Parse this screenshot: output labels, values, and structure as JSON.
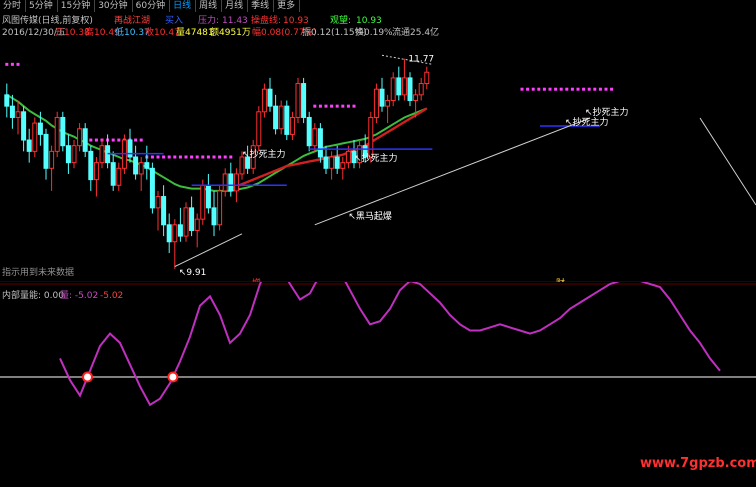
{
  "tabs": [
    "分时",
    "5分钟",
    "15分钟",
    "30分钟",
    "60分钟",
    "日线",
    "周线",
    "月线",
    "季线",
    "更多"
  ],
  "active_tab": 5,
  "header": {
    "title": "风图传媒(日线,前复权)",
    "signal": "再战江湖",
    "state": "买入",
    "resistance_label": "压力:",
    "resistance": "11.43",
    "stop_label": "操盘线:",
    "stop": "10.93",
    "watch_label": "观望:",
    "watch": "10.93"
  },
  "quote": {
    "date": "2016/12/30/五",
    "open_label": "开",
    "open": "10.38",
    "high_label": "高",
    "high": "10.49",
    "low_label": "低",
    "low": "10.37",
    "close_label": "收",
    "close": "10.47",
    "vol": "量47481",
    "amount": "额4951万",
    "change": "幅0.08(0.77%)",
    "amp": "振0.12(1.15%)",
    "turnover": "换0.19%",
    "float": "流通25.4亿"
  },
  "colors": {
    "up": "#ff3030",
    "down": "#54ffff",
    "green_ma": "#3dbd3d",
    "red_ma": "#d02020",
    "magenta": "#ff40ff",
    "blue_level": "#3030ff",
    "indicator": "#c030c0"
  },
  "chart_data": [
    {
      "type": "candlestick",
      "title": "风图传媒(日线,前复权)",
      "ylim": [
        9.9,
        11.9
      ],
      "annotations": [
        {
          "text": "11.77",
          "index": 71
        },
        {
          "text": "9.91",
          "index": 30
        },
        {
          "text": "抄死主力",
          "index": 44
        },
        {
          "text": "抄死主力",
          "index": 66
        },
        {
          "text": "黑马起爆",
          "index": 66
        },
        {
          "text": "抄死主力",
          "index": 113
        },
        {
          "text": "抄死主力",
          "index": 111
        }
      ],
      "watermark": "指示用到未来数据",
      "markers": [
        {
          "text": "增",
          "index": 49
        },
        {
          "text": "财",
          "index": 110
        }
      ],
      "candles": [
        [
          11.45,
          11.55,
          11.25,
          11.35
        ],
        [
          11.35,
          11.45,
          11.15,
          11.25
        ],
        [
          11.25,
          11.4,
          11.1,
          11.3
        ],
        [
          11.3,
          11.35,
          10.95,
          11.05
        ],
        [
          11.05,
          11.15,
          10.85,
          10.95
        ],
        [
          10.95,
          11.25,
          10.9,
          11.2
        ],
        [
          11.2,
          11.3,
          11.0,
          11.1
        ],
        [
          11.1,
          11.15,
          10.7,
          10.8
        ],
        [
          10.8,
          11.0,
          10.6,
          10.95
        ],
        [
          10.95,
          11.3,
          10.9,
          11.25
        ],
        [
          11.25,
          11.3,
          10.95,
          11.0
        ],
        [
          11.0,
          11.1,
          10.75,
          10.85
        ],
        [
          10.85,
          11.05,
          10.8,
          11.0
        ],
        [
          11.0,
          11.2,
          10.95,
          11.15
        ],
        [
          11.15,
          11.2,
          10.9,
          10.95
        ],
        [
          10.95,
          11.0,
          10.6,
          10.7
        ],
        [
          10.7,
          10.9,
          10.55,
          10.85
        ],
        [
          10.85,
          11.05,
          10.8,
          11.0
        ],
        [
          11.0,
          11.1,
          10.8,
          10.85
        ],
        [
          10.85,
          10.95,
          10.6,
          10.65
        ],
        [
          10.65,
          10.85,
          10.6,
          10.8
        ],
        [
          10.8,
          11.1,
          10.75,
          11.05
        ],
        [
          11.05,
          11.15,
          10.85,
          10.9
        ],
        [
          10.9,
          11.0,
          10.7,
          10.75
        ],
        [
          10.75,
          10.9,
          10.6,
          10.85
        ],
        [
          10.85,
          11.0,
          10.7,
          10.8
        ],
        [
          10.8,
          10.85,
          10.4,
          10.45
        ],
        [
          10.45,
          10.6,
          10.25,
          10.55
        ],
        [
          10.55,
          10.65,
          10.2,
          10.3
        ],
        [
          10.3,
          10.4,
          10.05,
          10.15
        ],
        [
          10.15,
          10.35,
          9.91,
          10.3
        ],
        [
          10.3,
          10.45,
          10.15,
          10.2
        ],
        [
          10.2,
          10.5,
          10.15,
          10.45
        ],
        [
          10.45,
          10.55,
          10.2,
          10.25
        ],
        [
          10.25,
          10.4,
          10.1,
          10.35
        ],
        [
          10.35,
          10.7,
          10.3,
          10.65
        ],
        [
          10.65,
          10.75,
          10.4,
          10.45
        ],
        [
          10.45,
          10.6,
          10.2,
          10.3
        ],
        [
          10.3,
          10.65,
          10.25,
          10.6
        ],
        [
          10.6,
          10.8,
          10.55,
          10.75
        ],
        [
          10.75,
          10.85,
          10.55,
          10.6
        ],
        [
          10.6,
          10.8,
          10.5,
          10.75
        ],
        [
          10.75,
          10.95,
          10.7,
          10.9
        ],
        [
          10.9,
          11.0,
          10.75,
          10.8
        ],
        [
          10.8,
          11.05,
          10.75,
          11.0
        ],
        [
          11.0,
          11.35,
          10.95,
          11.3
        ],
        [
          11.3,
          11.55,
          11.25,
          11.5
        ],
        [
          11.5,
          11.6,
          11.3,
          11.35
        ],
        [
          11.35,
          11.45,
          11.1,
          11.15
        ],
        [
          11.15,
          11.4,
          11.1,
          11.35
        ],
        [
          11.35,
          11.4,
          11.05,
          11.1
        ],
        [
          11.1,
          11.3,
          11.05,
          11.25
        ],
        [
          11.25,
          11.6,
          11.2,
          11.55
        ],
        [
          11.55,
          11.6,
          11.2,
          11.25
        ],
        [
          11.25,
          11.3,
          10.95,
          11.0
        ],
        [
          11.0,
          11.2,
          10.95,
          11.15
        ],
        [
          11.15,
          11.2,
          10.85,
          10.9
        ],
        [
          10.9,
          11.0,
          10.75,
          10.8
        ],
        [
          10.8,
          10.95,
          10.7,
          10.9
        ],
        [
          10.9,
          11.0,
          10.75,
          10.8
        ],
        [
          10.8,
          10.9,
          10.7,
          10.85
        ],
        [
          10.85,
          11.0,
          10.8,
          10.95
        ],
        [
          10.95,
          11.05,
          10.8,
          10.85
        ],
        [
          10.85,
          11.05,
          10.8,
          11.0
        ],
        [
          11.0,
          11.1,
          10.85,
          10.9
        ],
        [
          10.9,
          11.3,
          10.85,
          11.25
        ],
        [
          11.25,
          11.55,
          11.2,
          11.5
        ],
        [
          11.5,
          11.6,
          11.3,
          11.35
        ],
        [
          11.35,
          11.45,
          11.2,
          11.4
        ],
        [
          11.4,
          11.65,
          11.35,
          11.6
        ],
        [
          11.6,
          11.7,
          11.4,
          11.45
        ],
        [
          11.45,
          11.77,
          11.4,
          11.6
        ],
        [
          11.6,
          11.65,
          11.35,
          11.4
        ],
        [
          11.4,
          11.5,
          11.25,
          11.45
        ],
        [
          11.45,
          11.6,
          11.4,
          11.55
        ],
        [
          11.55,
          11.7,
          11.5,
          11.65
        ]
      ],
      "ma_green": [
        11.45,
        11.42,
        11.39,
        11.35,
        11.31,
        11.28,
        11.25,
        11.22,
        11.18,
        11.15,
        11.12,
        11.1,
        11.08,
        11.05,
        11.03,
        11.0,
        10.98,
        10.96,
        10.94,
        10.92,
        10.9,
        10.88,
        10.87,
        10.85,
        10.83,
        10.81,
        10.78,
        10.75,
        10.72,
        10.69,
        10.66,
        10.64,
        10.63,
        10.62,
        10.62,
        10.62,
        10.61,
        10.6,
        10.6,
        10.6,
        10.6,
        10.61,
        10.62,
        10.63,
        10.65,
        10.67,
        10.7,
        10.73,
        10.76,
        10.79,
        10.82,
        10.85,
        10.88,
        10.91,
        10.93,
        10.95,
        10.97,
        10.99,
        11.0,
        11.01,
        11.02,
        11.03,
        11.04,
        11.05,
        11.06,
        11.08,
        11.1,
        11.13,
        11.16,
        11.19,
        11.22,
        11.25,
        11.27,
        11.29,
        11.31,
        11.33
      ],
      "ma_red": [
        null,
        null,
        null,
        null,
        null,
        null,
        null,
        null,
        null,
        null,
        null,
        null,
        null,
        null,
        null,
        null,
        null,
        null,
        null,
        null,
        null,
        null,
        null,
        null,
        null,
        null,
        null,
        null,
        null,
        null,
        null,
        null,
        null,
        null,
        null,
        null,
        null,
        null,
        null,
        null,
        10.62,
        10.64,
        10.66,
        10.68,
        10.7,
        10.72,
        10.74,
        10.76,
        10.78,
        10.8,
        10.82,
        10.83,
        10.84,
        10.85,
        10.86,
        10.87,
        10.88,
        10.89,
        10.9,
        10.91,
        10.92,
        10.94,
        10.96,
        10.98,
        11.0,
        11.03,
        11.06,
        11.09,
        11.12,
        11.15,
        11.18,
        11.21,
        11.24,
        11.27,
        11.3,
        11.33
      ]
    },
    {
      "type": "line",
      "title": "内部量能",
      "values_text": [
        "0.00",
        "量: -5.02",
        "-5.02"
      ],
      "values": [
        12,
        -2,
        -12,
        4,
        20,
        28,
        22,
        8,
        -6,
        -18,
        -14,
        -4,
        10,
        26,
        46,
        52,
        40,
        22,
        28,
        40,
        60,
        74,
        72,
        60,
        50,
        54,
        66,
        74,
        68,
        56,
        44,
        34,
        36,
        44,
        56,
        62,
        60,
        54,
        48,
        40,
        34,
        30,
        30,
        32,
        34,
        32,
        30,
        28,
        30,
        34,
        38,
        44,
        48,
        52,
        56,
        60,
        62,
        64,
        62,
        60,
        58,
        50,
        40,
        30,
        22,
        12,
        4
      ],
      "baseline": 0
    }
  ],
  "footer": {
    "watermark": "www.7gpzb.com"
  }
}
